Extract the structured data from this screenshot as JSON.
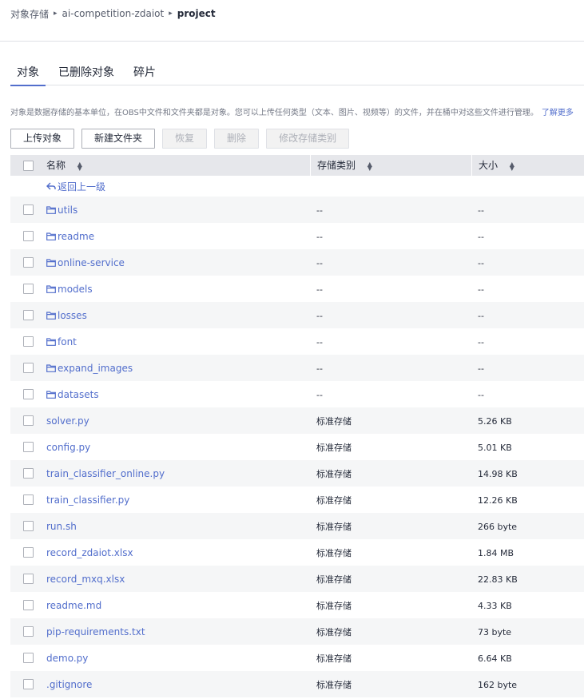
{
  "breadcrumb": [
    "对象存储",
    "ai-competition-zdaiot",
    "project"
  ],
  "tabs": [
    {
      "label": "对象",
      "active": true
    },
    {
      "label": "已删除对象",
      "active": false
    },
    {
      "label": "碎片",
      "active": false
    }
  ],
  "description": {
    "text": "对象是数据存储的基本单位，在OBS中文件和文件夹都是对象。您可以上传任何类型（文本、图片、视频等）的文件，并在桶中对这些文件进行管理。",
    "link": "了解更多"
  },
  "toolbar": {
    "upload": "上传对象",
    "new_folder": "新建文件夹",
    "restore": "恢复",
    "delete": "删除",
    "change_storage": "修改存储类别"
  },
  "table": {
    "headers": {
      "name": "名称",
      "storage": "存储类别",
      "size": "大小"
    },
    "back_label": "返回上一级",
    "rows": [
      {
        "name": "utils",
        "folder": true,
        "storage": "--",
        "size": "--"
      },
      {
        "name": "readme",
        "folder": true,
        "storage": "--",
        "size": "--"
      },
      {
        "name": "online-service",
        "folder": true,
        "storage": "--",
        "size": "--"
      },
      {
        "name": "models",
        "folder": true,
        "storage": "--",
        "size": "--"
      },
      {
        "name": "losses",
        "folder": true,
        "storage": "--",
        "size": "--"
      },
      {
        "name": "font",
        "folder": true,
        "storage": "--",
        "size": "--"
      },
      {
        "name": "expand_images",
        "folder": true,
        "storage": "--",
        "size": "--"
      },
      {
        "name": "datasets",
        "folder": true,
        "storage": "--",
        "size": "--"
      },
      {
        "name": "solver.py",
        "folder": false,
        "storage": "标准存储",
        "size": "5.26 KB"
      },
      {
        "name": "config.py",
        "folder": false,
        "storage": "标准存储",
        "size": "5.01 KB"
      },
      {
        "name": "train_classifier_online.py",
        "folder": false,
        "storage": "标准存储",
        "size": "14.98 KB"
      },
      {
        "name": "train_classifier.py",
        "folder": false,
        "storage": "标准存储",
        "size": "12.26 KB"
      },
      {
        "name": "run.sh",
        "folder": false,
        "storage": "标准存储",
        "size": "266 byte"
      },
      {
        "name": "record_zdaiot.xlsx",
        "folder": false,
        "storage": "标准存储",
        "size": "1.84 MB"
      },
      {
        "name": "record_mxq.xlsx",
        "folder": false,
        "storage": "标准存储",
        "size": "22.83 KB"
      },
      {
        "name": "readme.md",
        "folder": false,
        "storage": "标准存储",
        "size": "4.33 KB"
      },
      {
        "name": "pip-requirements.txt",
        "folder": false,
        "storage": "标准存储",
        "size": "73 byte"
      },
      {
        "name": "demo.py",
        "folder": false,
        "storage": "标准存储",
        "size": "6.64 KB"
      },
      {
        "name": ".gitignore",
        "folder": false,
        "storage": "标准存储",
        "size": "162 byte"
      }
    ]
  },
  "colors": {
    "accent": "#526ecc",
    "header_bg": "#e6e7eb",
    "alt_row": "#f5f6f7"
  }
}
